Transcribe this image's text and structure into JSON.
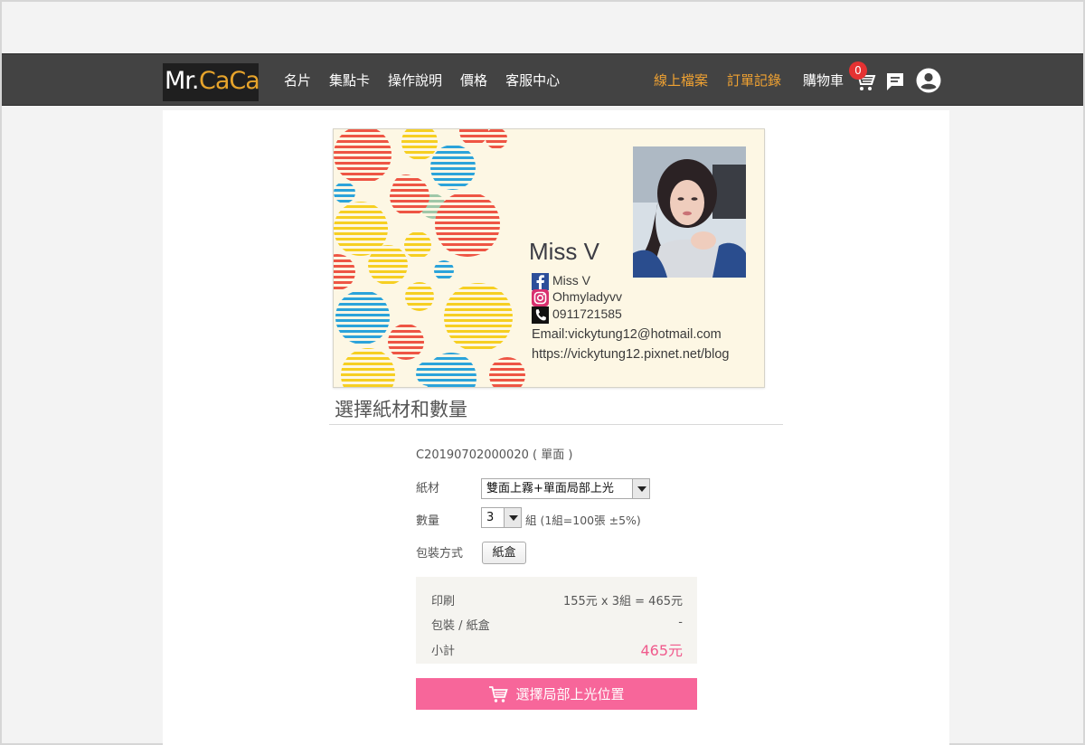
{
  "brand": {
    "mr": "Mr.",
    "caca": "CaCa"
  },
  "nav": {
    "items": [
      "名片",
      "集點卡",
      "操作說明",
      "價格",
      "客服中心"
    ],
    "upload": "線上檔案",
    "orders": "訂單記錄",
    "cart": "購物車",
    "cart_count": "0"
  },
  "card": {
    "name": "Miss V",
    "facebook": "Miss V",
    "instagram": "Ohmyladyvv",
    "phone": "0911721585",
    "email": "Email:vickytung12@hotmail.com",
    "blog": "https://vickytung12.pixnet.net/blog"
  },
  "section": {
    "title": "選擇紙材和數量",
    "order_id": "C20190702000020 ( 單面 )"
  },
  "form": {
    "paper_label": "紙材",
    "paper_value": "雙面上霧+單面局部上光",
    "qty_label": "數量",
    "qty_value": "3",
    "qty_note": "組 (1組=100張 ±5%)",
    "pack_label": "包裝方式",
    "pack_button": "紙盒"
  },
  "summary": {
    "print_label": "印刷",
    "print_value": "155元 x 3組 = 465元",
    "pack_label": "包裝 / 紙盒",
    "pack_value": "-",
    "subtotal_label": "小計",
    "subtotal_value": "465元"
  },
  "cta": {
    "label": "選擇局部上光位置"
  },
  "colors": {
    "accent": "#f0a232",
    "pink": "#f7669a",
    "topbar": "#434343"
  }
}
